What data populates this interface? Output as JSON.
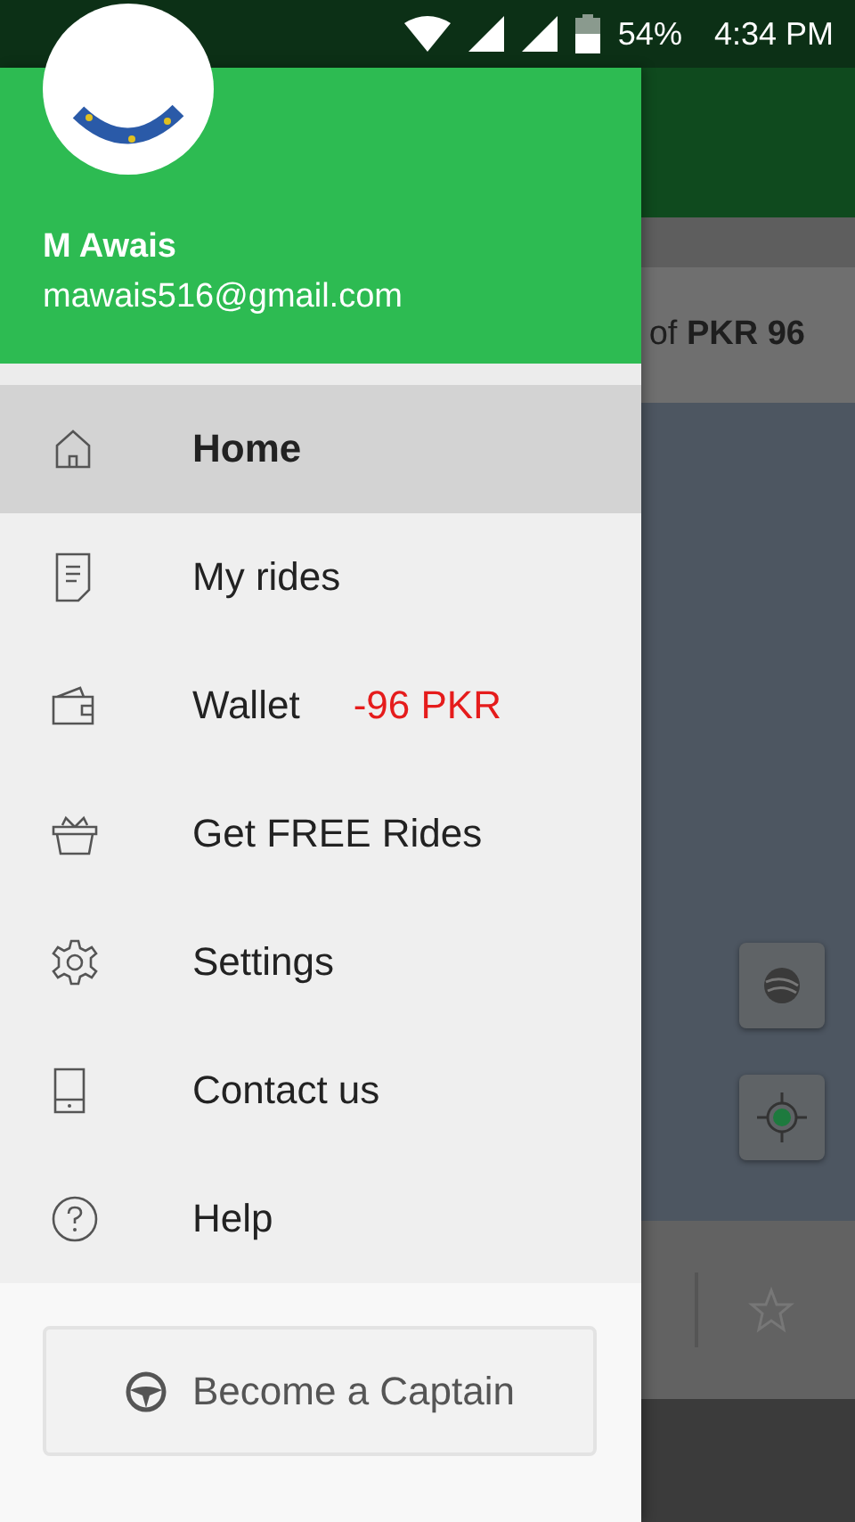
{
  "status_bar": {
    "battery": "54%",
    "time": "4:34 PM"
  },
  "drawer": {
    "user": {
      "name": "M Awais",
      "email": "mawais516@gmail.com"
    },
    "items": [
      {
        "label": "Home",
        "selected": true
      },
      {
        "label": "My rides",
        "selected": false
      },
      {
        "label": "Wallet",
        "selected": false,
        "badge": "-96 PKR"
      },
      {
        "label": "Get FREE Rides",
        "selected": false
      },
      {
        "label": "Settings",
        "selected": false
      },
      {
        "label": "Contact us",
        "selected": false
      },
      {
        "label": "Help",
        "selected": false
      }
    ],
    "action_button": "Become a Captain"
  },
  "background": {
    "fare_text": "of **PKR 96**"
  }
}
